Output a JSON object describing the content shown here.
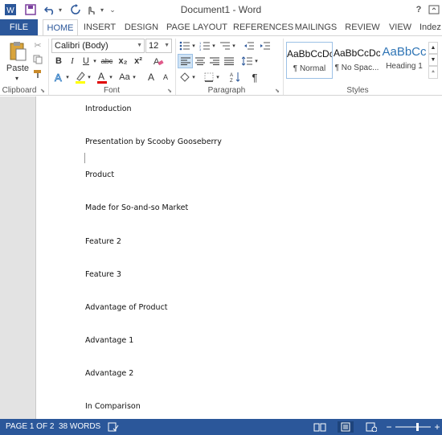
{
  "window": {
    "title": "Document1 - Word",
    "help": "?"
  },
  "tabs": [
    "FILE",
    "HOME",
    "INSERT",
    "DESIGN",
    "PAGE LAYOUT",
    "REFERENCES",
    "MAILINGS",
    "REVIEW",
    "VIEW",
    "Indez"
  ],
  "active_tab": "HOME",
  "ribbon": {
    "clipboard": {
      "paste_label": "Paste",
      "group_label": "Clipboard"
    },
    "font": {
      "font_name": "Calibri (Body)",
      "font_size": "12",
      "group_label": "Font",
      "bold": "B",
      "italic": "I",
      "underline": "U",
      "strike": "abc",
      "subscript": "x₂",
      "superscript": "x²",
      "change_case": "Aa",
      "grow": "A",
      "shrink": "A",
      "font_color": "A"
    },
    "paragraph": {
      "group_label": "Paragraph",
      "show_marks": "¶"
    },
    "styles": {
      "group_label": "Styles",
      "items": [
        {
          "sample": "AaBbCcDc",
          "name": "¶ Normal"
        },
        {
          "sample": "AaBbCcDc",
          "name": "¶ No Spac..."
        },
        {
          "sample": "AaBbCc",
          "name": "Heading 1"
        }
      ],
      "heading_color": "#2e74b5"
    }
  },
  "document": {
    "paragraphs": [
      "Introduction",
      "Presentation by Scooby Gooseberry",
      "Product",
      "Made for So-and-so Market",
      "Feature 2",
      "Feature 3",
      "Advantage of Product",
      "Advantage 1",
      "Advantage 2",
      "In Comparison"
    ]
  },
  "status": {
    "page": "PAGE 1 OF 2",
    "words": "38 WORDS"
  },
  "colors": {
    "accent": "#2b579a",
    "font_color_bar": "#e00000",
    "highlight_bar": "#ffff00"
  }
}
